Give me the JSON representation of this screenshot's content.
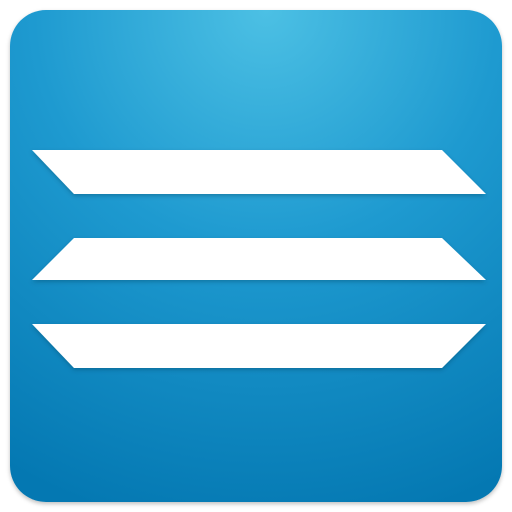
{
  "icon": {
    "name": "menu-lines-icon",
    "colors": {
      "gradient_top": "#4cc0e4",
      "gradient_mid": "#1e9ad0",
      "gradient_bottom": "#0478b2",
      "glyph": "#ffffff"
    }
  }
}
